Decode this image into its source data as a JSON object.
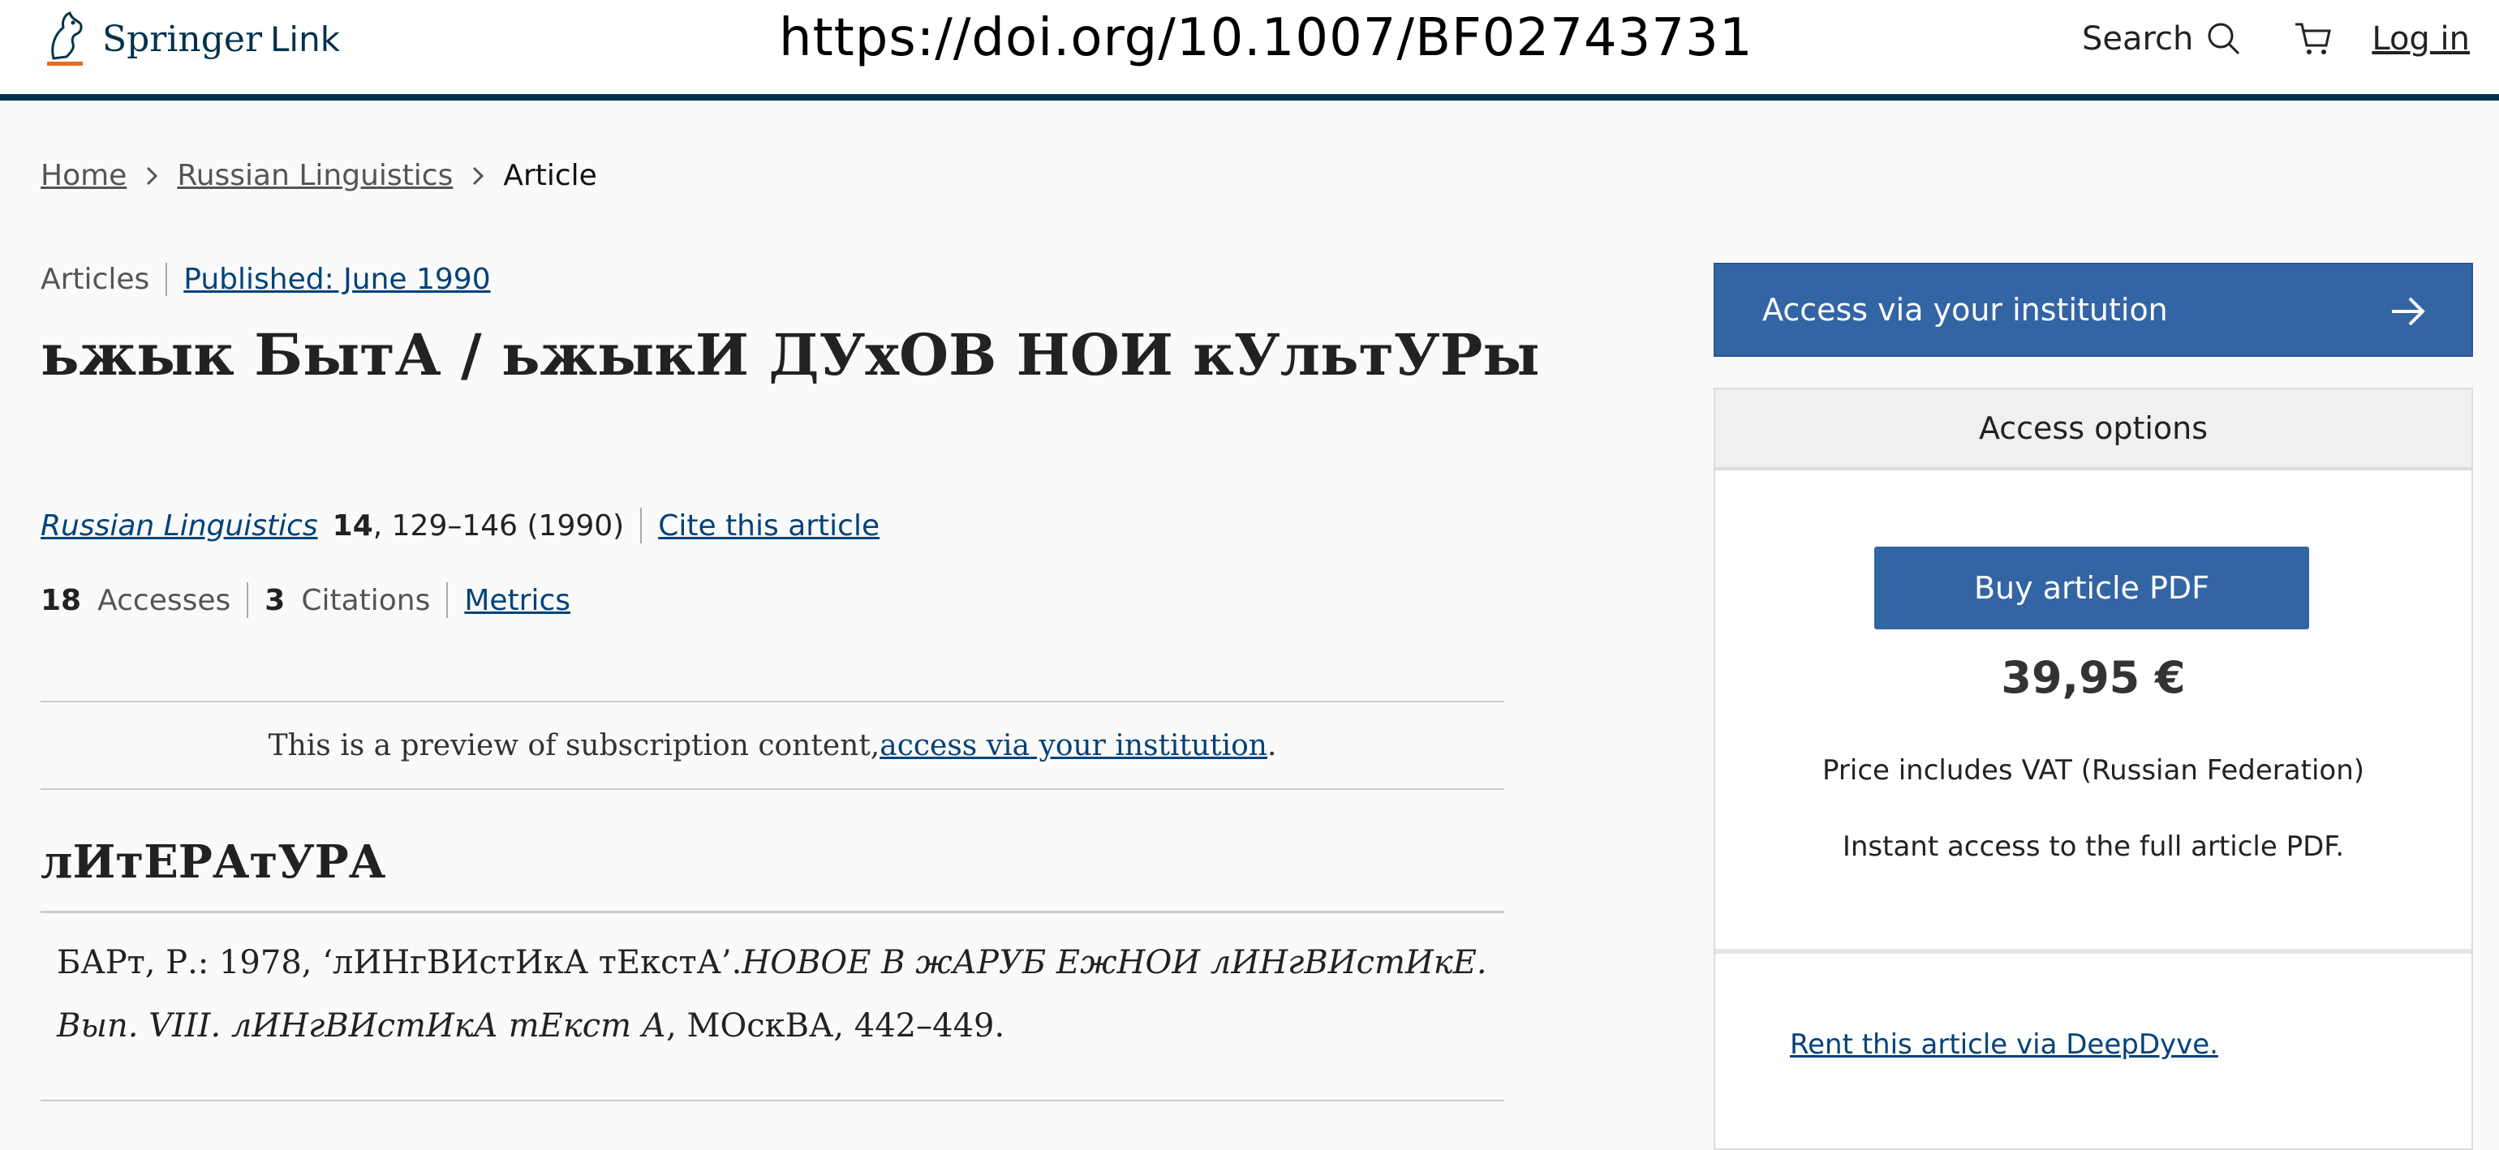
{
  "header": {
    "logo_text": "Springer",
    "logo_suffix": "Link",
    "doi_url": "https://doi.org/10.1007/BF02743731",
    "search_label": "Search",
    "login_label": "Log in"
  },
  "breadcrumb": {
    "home": "Home",
    "journal": "Russian Linguistics",
    "current": "Article"
  },
  "article": {
    "type": "Articles",
    "published": "Published: June 1990",
    "title": "ьжык БытА / ьжыкИ ДУхОВ НОИ кУльтУРы",
    "journal_name": "Russian Linguistics",
    "volume": "14",
    "pages_year": ", 129–146 (1990)",
    "cite_label": "Cite this article",
    "accesses_num": "18",
    "accesses_label": "Accesses",
    "citations_num": "3",
    "citations_label": "Citations",
    "metrics_label": "Metrics"
  },
  "preview": {
    "text": "This is a preview of subscription content, ",
    "link": "access via your institution",
    "end": "."
  },
  "literature": {
    "heading": "лИтЕРАтУРА",
    "ref1_part1": "БАРт, Р.: 1978, ‘лИНгВИстИкА тЕкстА’.",
    "ref1_italic1": "НОВОЕ В жАРУБ ЕжНОИ лИНгВИстИкЕ. Вып. VIII. лИНгВИстИкА тЕкст А",
    "ref1_part2": ", МОскВА, 442–449."
  },
  "sidebar": {
    "access_institution": "Access via your institution",
    "options_header": "Access options",
    "buy_pdf": "Buy article PDF",
    "price": "39,95 €",
    "vat_note": "Price includes VAT (Russian Federation)",
    "instant_note": "Instant access to the full article PDF.",
    "rent_link": "Rent this article via DeepDyve."
  }
}
